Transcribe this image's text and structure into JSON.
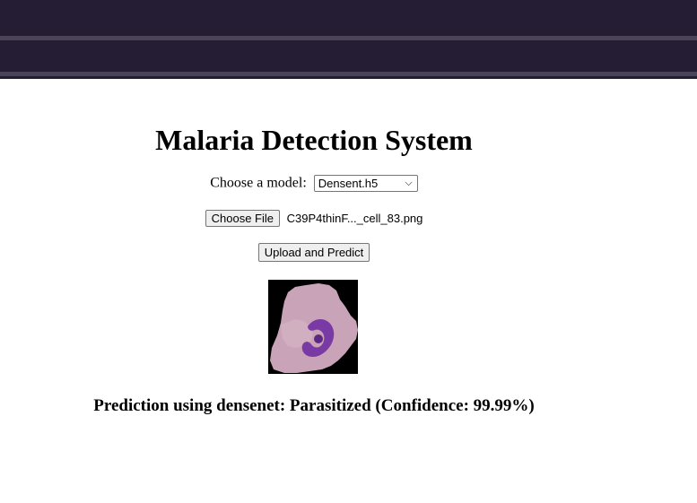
{
  "header": {
    "colors": {
      "bar": "#241d33",
      "stripe": "#4a4458"
    }
  },
  "main": {
    "title": "Malaria Detection System",
    "model": {
      "label": "Choose a model:",
      "selected": "Densent.h5",
      "chevron_icon": "chevron-down-icon"
    },
    "file": {
      "button_label": "Choose File",
      "file_name": "C39P4thinF..._cell_83.png"
    },
    "upload_button_label": "Upload and Predict",
    "cell_image": {
      "description_icon": "cell-image",
      "colors": {
        "background": "#000000",
        "cell": "#c9a3b8",
        "stain": "#7a3aa5"
      }
    },
    "prediction_text": "Prediction using densenet: Parasitized (Confidence: 99.99%)"
  }
}
